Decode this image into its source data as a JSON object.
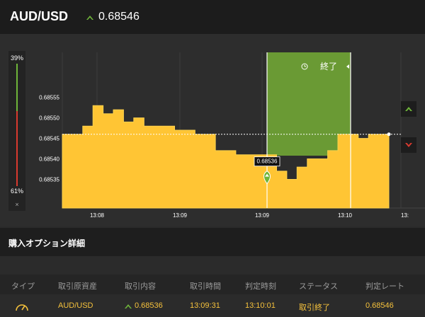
{
  "header": {
    "pair": "AUD/USD",
    "rate": "0.68546",
    "direction": "up"
  },
  "colors": {
    "accent_yellow": "#ffc534",
    "up_green": "#6fb53a",
    "down_red": "#d93a2f",
    "panel_green": "#6a9a34"
  },
  "sentiment": {
    "up_pct": "39%",
    "down_pct": "61%",
    "close_label": "×"
  },
  "chart_data": {
    "type": "area",
    "y_ticks": [
      "0.68555",
      "0.68550",
      "0.68545",
      "0.68540",
      "0.68535"
    ],
    "y_tick_values": [
      0.68555,
      0.6855,
      0.68545,
      0.6854,
      0.68535
    ],
    "x_ticks": [
      "13:08",
      "13:09",
      "13:09",
      "13:10",
      "13:"
    ],
    "ylim": [
      0.68528,
      0.68566
    ],
    "current_rate": 0.68546,
    "entry_label": "0.68536",
    "entry_value": 0.68536,
    "period_label": "終了",
    "series": [
      {
        "values": [
          0.68546,
          0.68546,
          0.68548,
          0.68553,
          0.68551,
          0.68552,
          0.68549,
          0.6855,
          0.68548,
          0.68548,
          0.68548,
          0.68547,
          0.68547,
          0.68546,
          0.68546,
          0.68542,
          0.68542,
          0.68541,
          0.68541,
          0.68541,
          0.68541,
          0.68537,
          0.68535,
          0.68538,
          0.6854,
          0.6854,
          0.68542,
          0.68546,
          0.68546,
          0.68545,
          0.68546,
          0.68546,
          0.68546
        ]
      }
    ]
  },
  "details": {
    "title": "購入オプション詳細"
  },
  "table": {
    "headers": [
      "タイプ",
      "取引原資産",
      "取引内容",
      "取引時間",
      "判定時刻",
      "ステータス",
      "判定レート"
    ],
    "row": {
      "asset": "AUD/USD",
      "content": "0.68536",
      "trade_time": "13:09:31",
      "judge_time": "13:10:01",
      "status": "取引終了",
      "judge_rate": "0.68546"
    }
  }
}
